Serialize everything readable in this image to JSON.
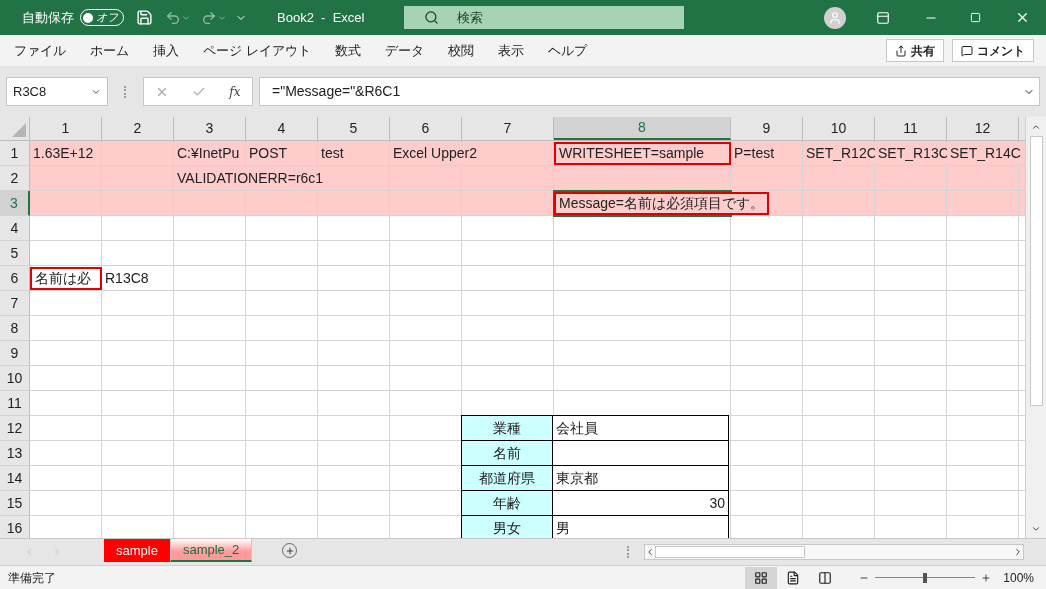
{
  "title_bar": {
    "autosave_label": "自動保存",
    "autosave_toggle": {
      "on": false,
      "label": "オフ"
    },
    "title": "Book2  -  Excel",
    "search": {
      "placeholder": "検索"
    }
  },
  "menu": {
    "items": [
      "ファイル",
      "ホーム",
      "挿入",
      "ページ レイアウト",
      "数式",
      "データ",
      "校閲",
      "表示",
      "ヘルプ"
    ],
    "share": "共有",
    "comment": "コメント"
  },
  "formula_bar": {
    "name_box": "R3C8",
    "fx": "fx",
    "formula": "=\"Message=\"&R6C1"
  },
  "sheet": {
    "columns": [
      {
        "label": "1",
        "selected": false
      },
      {
        "label": "2",
        "selected": false
      },
      {
        "label": "3",
        "selected": false
      },
      {
        "label": "4",
        "selected": false
      },
      {
        "label": "5",
        "selected": false
      },
      {
        "label": "6",
        "selected": false
      },
      {
        "label": "7",
        "selected": false
      },
      {
        "label": "8",
        "selected": true
      },
      {
        "label": "9",
        "selected": false
      },
      {
        "label": "10",
        "selected": false
      },
      {
        "label": "11",
        "selected": false
      },
      {
        "label": "12",
        "selected": false
      }
    ],
    "rows": [
      {
        "label": "1",
        "selected": false,
        "color": "#ffcccc",
        "cells": [
          {
            "text": "1.63E+12",
            "kind": "text",
            "boxed": false
          },
          null,
          {
            "text": "C:¥InetPu",
            "kind": "text",
            "boxed": false
          },
          {
            "text": "POST",
            "kind": "text",
            "boxed": false
          },
          {
            "text": "test",
            "kind": "text",
            "boxed": false
          },
          {
            "text": "Excel Upper2",
            "kind": "text",
            "boxed": false
          },
          null,
          {
            "text": "WRITESHEET=sample",
            "kind": "text",
            "boxed": true
          },
          {
            "text": "P=test",
            "kind": "text",
            "boxed": false
          },
          {
            "text": "SET_R12C",
            "kind": "text",
            "boxed": false
          },
          {
            "text": "SET_R13C",
            "kind": "text",
            "boxed": false
          },
          {
            "text": "SET_R14C",
            "kind": "text",
            "boxed": false
          }
        ]
      },
      {
        "label": "2",
        "selected": false,
        "color": "#ffcccc",
        "cells": [
          null,
          null,
          {
            "text": "VALIDATIONERR=r6c1",
            "kind": "text",
            "boxed": false
          }
        ]
      },
      {
        "label": "3",
        "selected": true,
        "color": "#ffcccc",
        "cells": [
          null,
          null,
          null,
          null,
          null,
          null,
          null,
          {
            "text": "Message=名前は必須項目です。",
            "kind": "text",
            "boxed": true
          }
        ]
      },
      {
        "label": "4",
        "selected": false,
        "cells": []
      },
      {
        "label": "5",
        "selected": false,
        "cells": []
      },
      {
        "label": "6",
        "selected": false,
        "cells": [
          {
            "text": "名前は必",
            "kind": "text",
            "boxed": true
          },
          {
            "text": "R13C8",
            "kind": "text",
            "boxed": false
          }
        ]
      },
      {
        "label": "7",
        "selected": false,
        "cells": []
      },
      {
        "label": "8",
        "selected": false,
        "cells": []
      },
      {
        "label": "9",
        "selected": false,
        "cells": []
      },
      {
        "label": "10",
        "selected": false,
        "cells": []
      },
      {
        "label": "11",
        "selected": false,
        "cells": []
      },
      {
        "label": "12",
        "selected": false,
        "cells": [
          null,
          null,
          null,
          null,
          null,
          null,
          {
            "text": "業種",
            "kind": "label",
            "boxed": false
          },
          {
            "text": "会社員",
            "kind": "value",
            "boxed": false
          }
        ]
      },
      {
        "label": "13",
        "selected": false,
        "cells": [
          null,
          null,
          null,
          null,
          null,
          null,
          {
            "text": "名前",
            "kind": "label",
            "boxed": false
          },
          {
            "kind": "value",
            "boxed": false
          }
        ]
      },
      {
        "label": "14",
        "selected": false,
        "cells": [
          null,
          null,
          null,
          null,
          null,
          null,
          {
            "text": "都道府県",
            "kind": "label",
            "boxed": false
          },
          {
            "text": "東京都",
            "kind": "value",
            "boxed": false
          }
        ]
      },
      {
        "label": "15",
        "selected": false,
        "cells": [
          null,
          null,
          null,
          null,
          null,
          null,
          {
            "text": "年齢",
            "kind": "label",
            "boxed": false
          },
          {
            "text": "30",
            "kind": "number",
            "boxed": false
          }
        ]
      },
      {
        "label": "16",
        "selected": false,
        "cells": [
          null,
          null,
          null,
          null,
          null,
          null,
          {
            "text": "男女",
            "kind": "label",
            "boxed": false
          },
          {
            "text": "男",
            "kind": "value",
            "boxed": false
          }
        ]
      }
    ]
  },
  "sheet_tabs": [
    {
      "label": "sample",
      "selected": false,
      "color": "#ff0000"
    },
    {
      "label": "sample_2",
      "selected": true,
      "color": "#ff9a9a"
    }
  ],
  "status_bar": {
    "status": "準備完了",
    "views": [
      {
        "kind": "normal",
        "selected": true
      },
      {
        "kind": "page-layout",
        "selected": false
      },
      {
        "kind": "page-break",
        "selected": false
      }
    ],
    "zoom": {
      "level": 0.5,
      "reading": "100%"
    }
  }
}
